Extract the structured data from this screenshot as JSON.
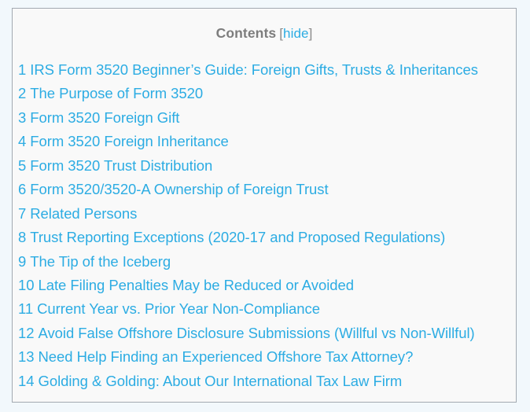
{
  "colors": {
    "page_background": "#f2f8fc",
    "box_background": "#f9f9f9",
    "box_border": "#a2a9b1",
    "link_blue": "#2cace3",
    "title_gray": "#7d7d7d",
    "bracket_gray": "#8a8a8a"
  },
  "toc": {
    "title": "Contents",
    "toggle": {
      "open_bracket": "[",
      "link_label": "hide",
      "close_bracket": "]"
    },
    "items": [
      {
        "number": "1",
        "label": "IRS Form 3520 Beginner’s Guide: Foreign Gifts, Trusts & Inheritances"
      },
      {
        "number": "2",
        "label": "The Purpose of Form 3520"
      },
      {
        "number": "3",
        "label": "Form 3520 Foreign Gift"
      },
      {
        "number": "4",
        "label": "Form 3520 Foreign Inheritance"
      },
      {
        "number": "5",
        "label": "Form 3520 Trust Distribution"
      },
      {
        "number": "6",
        "label": "Form 3520/3520-A Ownership of Foreign Trust"
      },
      {
        "number": "7",
        "label": "Related Persons"
      },
      {
        "number": "8",
        "label": "Trust Reporting Exceptions (2020-17 and Proposed Regulations)"
      },
      {
        "number": "9",
        "label": "The Tip of the Iceberg"
      },
      {
        "number": "10",
        "label": "Late Filing Penalties May be Reduced or Avoided"
      },
      {
        "number": "11",
        "label": "Current Year vs. Prior Year Non-Compliance"
      },
      {
        "number": "12",
        "label": "Avoid False Offshore Disclosure Submissions (Willful vs Non-Willful)"
      },
      {
        "number": "13",
        "label": "Need Help Finding an Experienced Offshore Tax Attorney?"
      },
      {
        "number": "14",
        "label": "Golding & Golding: About Our International Tax Law Firm"
      }
    ]
  }
}
